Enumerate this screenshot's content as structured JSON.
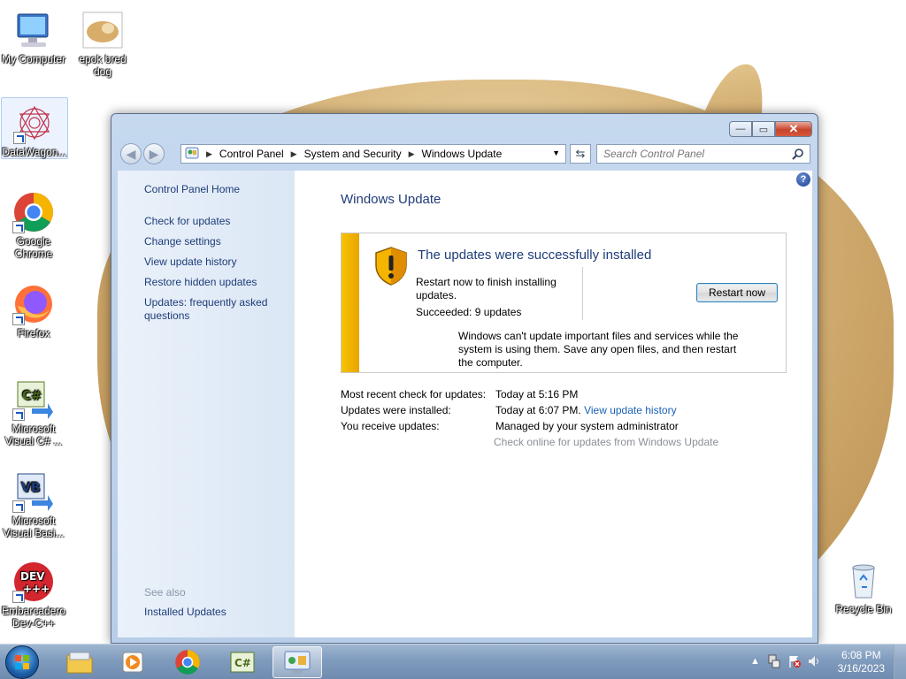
{
  "desktop": {
    "icons": [
      {
        "label": "My Computer"
      },
      {
        "label": "epok bred dog"
      },
      {
        "label": "DataWagon..."
      },
      {
        "label": "Google Chrome"
      },
      {
        "label": "Firefox"
      },
      {
        "label": "Microsoft Visual C# ..."
      },
      {
        "label": "Microsoft Visual Basi..."
      },
      {
        "label": "Embarcadero Dev-C++"
      },
      {
        "label": "Recycle Bin"
      }
    ]
  },
  "window": {
    "controls": {
      "minimize": "—",
      "maximize": "▭",
      "close": "✕"
    },
    "breadcrumb": [
      "Control Panel",
      "System and Security",
      "Windows Update"
    ],
    "search": {
      "placeholder": "Search Control Panel"
    },
    "left_pane": {
      "home": "Control Panel Home",
      "links": [
        "Check for updates",
        "Change settings",
        "View update history",
        "Restore hidden updates",
        "Updates: frequently asked questions"
      ],
      "see_also": "See also",
      "see_also_links": [
        "Installed Updates"
      ]
    },
    "main": {
      "title": "Windows Update",
      "status": {
        "title": "The updates were successfully installed",
        "text": "Restart now to finish installing updates.",
        "succeeded": "Succeeded: 9 updates",
        "button": "Restart now",
        "note": "Windows can't update important files and services while the system is using them. Save any open files, and then restart the computer."
      },
      "info": [
        {
          "label": "Most recent check for updates:",
          "value": "Today at 5:16 PM",
          "link": ""
        },
        {
          "label": "Updates were installed:",
          "value": "Today at 6:07 PM.",
          "link": "View update history"
        },
        {
          "label": "You receive updates:",
          "value": "Managed by your system administrator",
          "link": ""
        }
      ],
      "check_online": "Check online for updates from Windows Update"
    }
  },
  "taskbar": {
    "clock": {
      "time": "6:08 PM",
      "date": "3/16/2023"
    }
  },
  "colors": {
    "accent": "#1f3d7a",
    "link": "#1a5fb4",
    "warning": "#f6c300"
  }
}
